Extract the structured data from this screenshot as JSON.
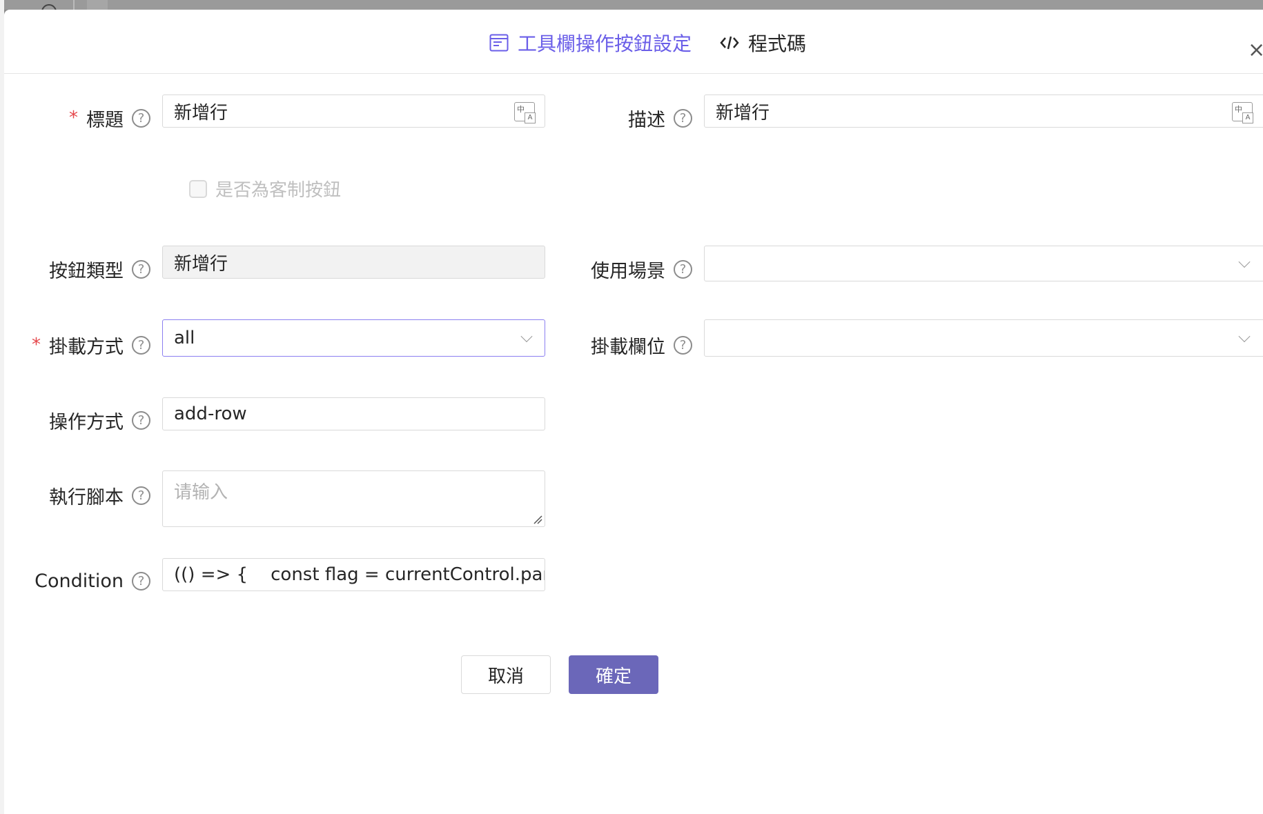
{
  "header": {
    "tabs": [
      {
        "label": "工具欄操作按鈕設定",
        "icon": "window-icon",
        "active": true
      },
      {
        "label": "程式碼",
        "icon": "code-icon",
        "active": false
      }
    ],
    "close_label": "×"
  },
  "form": {
    "title": {
      "label": "標題",
      "required": true,
      "value": "新增行"
    },
    "description": {
      "label": "描述",
      "value": "新增行"
    },
    "is_custom": {
      "label": "是否為客制按鈕",
      "checked": false,
      "disabled": true
    },
    "button_type": {
      "label": "按鈕類型",
      "value": "新增行",
      "disabled": true
    },
    "usage_scenario": {
      "label": "使用場景",
      "value": ""
    },
    "mount_method": {
      "label": "掛載方式",
      "required": true,
      "value": "all"
    },
    "mount_field": {
      "label": "掛載欄位",
      "value": ""
    },
    "operation": {
      "label": "操作方式",
      "value": "add-row"
    },
    "script": {
      "label": "執行腳本",
      "placeholder": "请输入",
      "value": ""
    },
    "condition": {
      "label": "Condition",
      "value": "(() => {    const flag = currentControl.parent.pare..."
    }
  },
  "footer": {
    "cancel_label": "取消",
    "ok_label": "確定"
  },
  "colors": {
    "accent": "#6a5ee8",
    "primary_button": "#6b67b9",
    "required": "#e5474b"
  }
}
